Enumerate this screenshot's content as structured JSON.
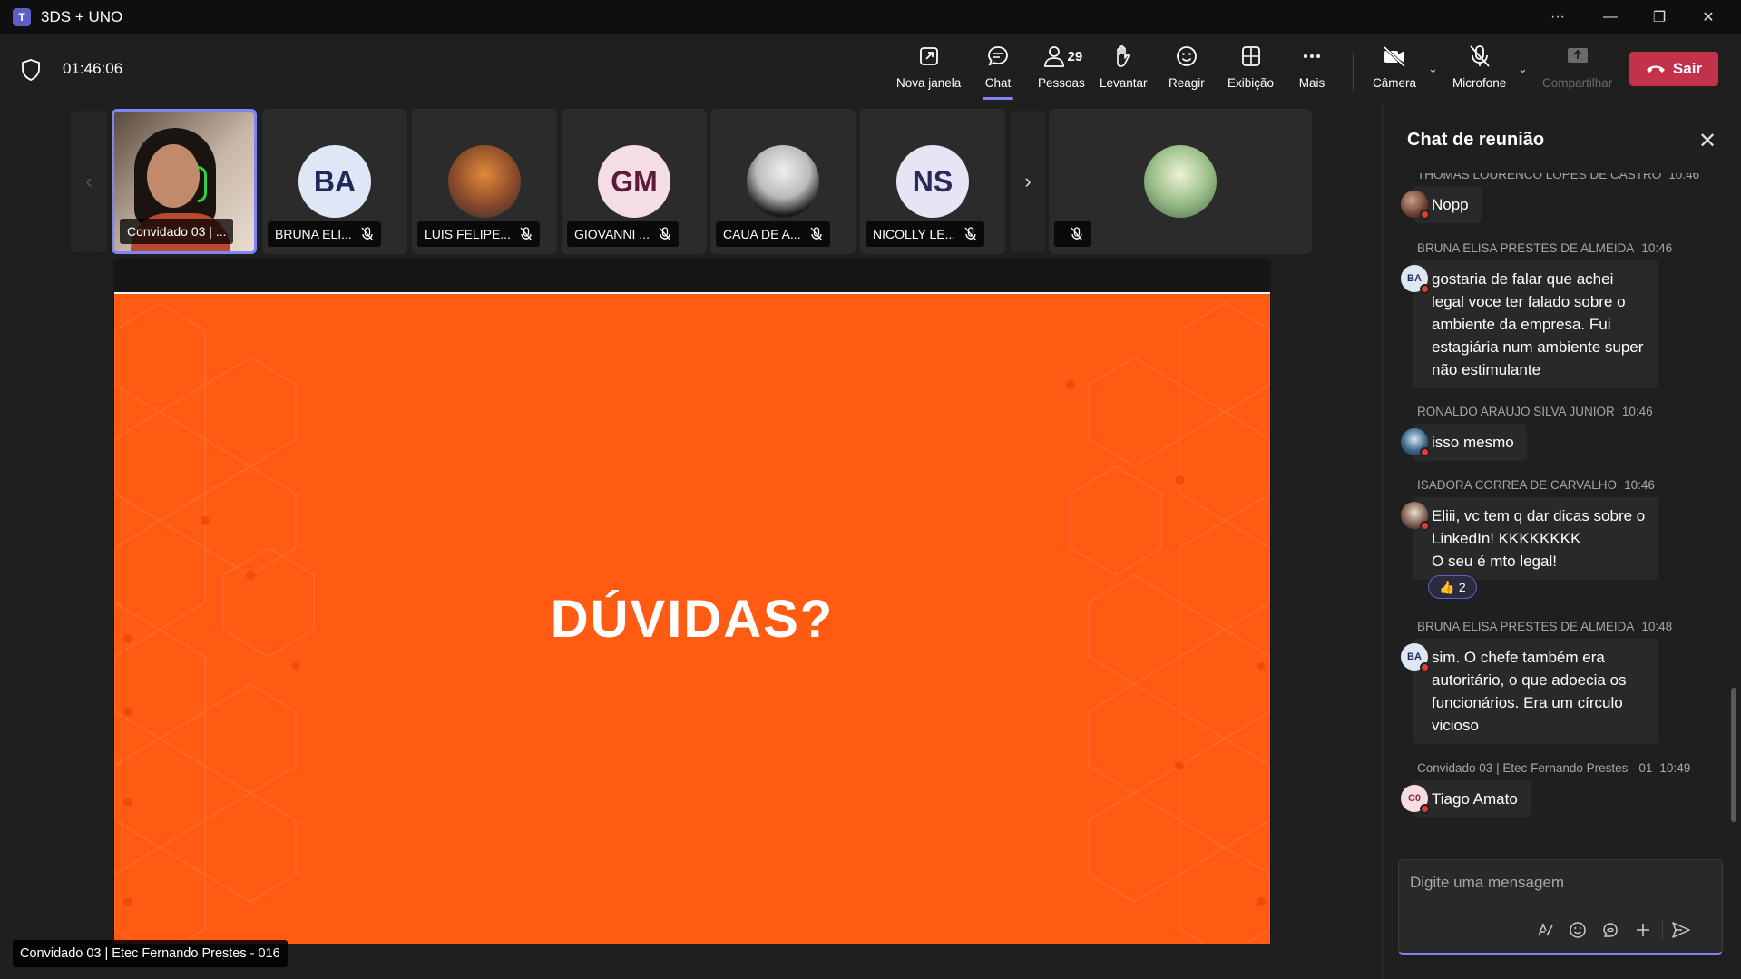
{
  "window": {
    "title": "3DS + UNO",
    "app_logo": "T"
  },
  "meeting": {
    "elapsed": "01:46:06"
  },
  "toolbar": {
    "new_window": "Nova janela",
    "chat": "Chat",
    "people": "Pessoas",
    "people_count": "29",
    "raise": "Levantar",
    "react": "Reagir",
    "view": "Exibição",
    "more": "Mais",
    "camera": "Câmera",
    "mic": "Microfone",
    "share": "Compartilhar",
    "leave": "Sair"
  },
  "participants": [
    {
      "name": "Convidado 03 | ..."
    },
    {
      "name": "BRUNA ELI...",
      "initials": "BA"
    },
    {
      "name": "LUIS FELIPE..."
    },
    {
      "name": "GIOVANNI ...",
      "initials": "GM"
    },
    {
      "name": "CAUA DE A..."
    },
    {
      "name": "NICOLLY LE...",
      "initials": "NS"
    },
    {
      "name": ""
    }
  ],
  "slide": {
    "heading": "DÚVIDAS?"
  },
  "speaker_label": "Convidado 03 | Etec Fernando Prestes - 016",
  "chat": {
    "title": "Chat de reunião",
    "messages": [
      {
        "sender": "THOMAS LOURENCO LOPES DE CASTRO",
        "time": "10:46",
        "text": "Nopp"
      },
      {
        "sender": "BRUNA ELISA PRESTES DE ALMEIDA",
        "time": "10:46",
        "initials": "BA",
        "text": "gostaria de falar que achei legal voce ter falado sobre o ambiente da empresa. Fui estagiária num ambiente super não estimulante"
      },
      {
        "sender": "RONALDO ARAUJO SILVA JUNIOR",
        "time": "10:46",
        "text": "isso mesmo"
      },
      {
        "sender": "ISADORA CORREA DE CARVALHO",
        "time": "10:46",
        "text_lines": [
          "Eliii, vc tem q dar dicas sobre o",
          "LinkedIn! KKKKKKKK",
          "O seu é mto legal!"
        ],
        "reaction": {
          "emoji": "👍",
          "count": "2"
        }
      },
      {
        "sender": "BRUNA ELISA PRESTES DE ALMEIDA",
        "time": "10:48",
        "initials": "BA",
        "text": "sim. O chefe também era autoritário, o que adoecia os funcionários. Era um círculo vicioso"
      },
      {
        "sender": "Convidado 03 | Etec Fernando Prestes - 01",
        "time": "10:49",
        "initials": "C0",
        "text": "Tiago Amato"
      }
    ],
    "compose_placeholder": "Digite uma mensagem"
  },
  "colors": {
    "accent": "#7f85f5",
    "leave": "#c4314b",
    "slide_bg": "#ff5b13"
  }
}
